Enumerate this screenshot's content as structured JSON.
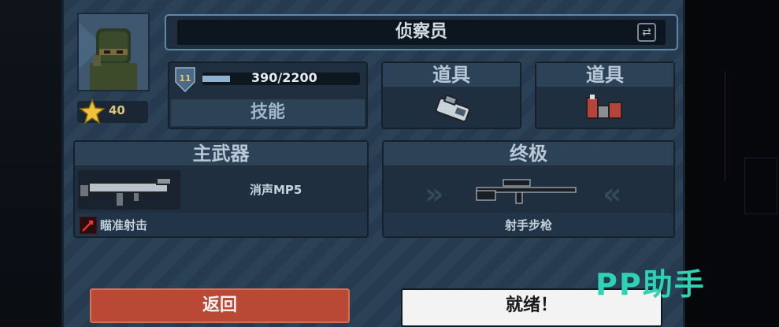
{
  "character": {
    "name": "侦察员",
    "level": "40",
    "rank": "11",
    "xp_text": "390/2200",
    "xp_progress": 0.177
  },
  "skill": {
    "label": "技能"
  },
  "items": [
    {
      "label": "道具",
      "icon": "mine-icon"
    },
    {
      "label": "道具",
      "icon": "explosive-charge-icon"
    }
  ],
  "primary_weapon": {
    "header": "主武器",
    "name": "消声MP5",
    "perk": "瞄准射击",
    "icon": "smg-icon"
  },
  "ultimate": {
    "header": "终极",
    "name": "射手步枪",
    "icon": "marksman-rifle-icon"
  },
  "buttons": {
    "back": "返回",
    "ready": "就绪！"
  },
  "watermark": "PP助手",
  "colors": {
    "back_button": "#b94934",
    "ready_button": "#f3f3f3",
    "watermark": "#2fd3b3"
  }
}
